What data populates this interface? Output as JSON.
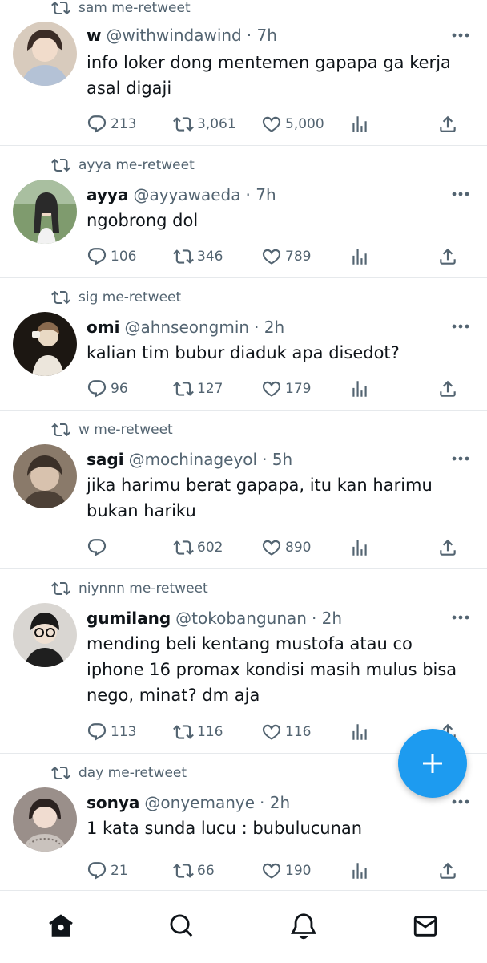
{
  "tweets": [
    {
      "retweeter": "sam me-retweet",
      "name": "w",
      "handle": "@withwindawind",
      "time": "· 7h",
      "lines": [
        "info loker dong mentemen gapapa ga kerja",
        "asal digaji"
      ],
      "replies": "213",
      "retweets": "3,061",
      "likes": "5,000",
      "avatar_colors": [
        "#c9b8a6",
        "#3a2c26"
      ]
    },
    {
      "retweeter": "ayya me-retweet",
      "name": "ayya",
      "handle": "@ayyawaeda",
      "time": "· 7h",
      "lines": [
        "ngobrong dol"
      ],
      "replies": "106",
      "retweets": "346",
      "likes": "789",
      "avatar_colors": [
        "#7f9b6e",
        "#2a2a2a"
      ]
    },
    {
      "retweeter": "sig me-retweet",
      "name": "omi",
      "handle": "@ahnseongmin",
      "time": "· 2h",
      "lines": [
        "kalian tim bubur diaduk apa disedot?"
      ],
      "replies": "96",
      "retweets": "127",
      "likes": "179",
      "avatar_colors": [
        "#1c1712",
        "#e9d9c4"
      ]
    },
    {
      "retweeter": "w me-retweet",
      "name": "sagi",
      "handle": "@mochinageyol",
      "time": "· 5h",
      "lines": [
        "jika harimu berat gapapa, itu kan harimu",
        "bukan hariku"
      ],
      "replies": "",
      "retweets": "602",
      "likes": "890",
      "avatar_colors": [
        "#8a7a6a",
        "#3b3028"
      ]
    },
    {
      "retweeter": "niynnn me-retweet",
      "name": "gumilang",
      "handle": "@tokobangunan",
      "time": "· 2h",
      "lines": [
        "mending beli kentang mustofa atau co",
        "iphone 16 promax kondisi masih mulus bisa",
        "nego, minat? dm aja"
      ],
      "replies": "113",
      "retweets": "116",
      "likes": "116",
      "avatar_colors": [
        "#d9d6d2",
        "#1a1a1a"
      ]
    },
    {
      "retweeter": "day me-retweet",
      "name": "sonya",
      "handle": "@onyemanye",
      "time": "· 2h",
      "lines": [
        "1 kata sunda lucu : bubulucunan"
      ],
      "replies": "21",
      "retweets": "66",
      "likes": "190",
      "avatar_colors": [
        "#9a8f8a",
        "#2b2220"
      ]
    }
  ],
  "fab": {
    "icon": "plus-icon",
    "color": "#1d9bf0"
  },
  "bottom_nav": [
    {
      "icon": "home-icon"
    },
    {
      "icon": "search-icon"
    },
    {
      "icon": "bell-icon"
    },
    {
      "icon": "mail-icon"
    }
  ],
  "colors": {
    "secondary_text": "#536471",
    "accent": "#1d9bf0",
    "divider": "#e6e9ec"
  }
}
